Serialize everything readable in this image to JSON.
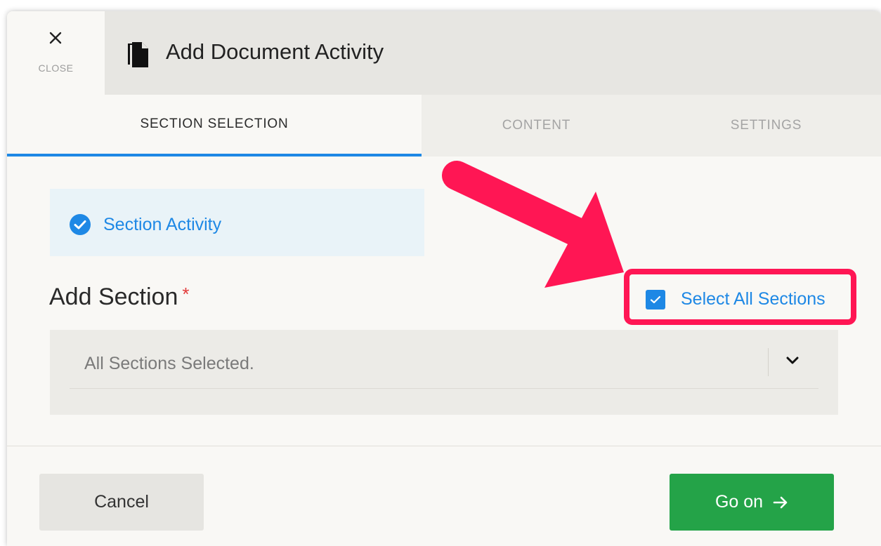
{
  "header": {
    "close_label": "CLOSE",
    "title": "Add Document Activity"
  },
  "tabs": [
    {
      "label": "SECTION SELECTION",
      "active": true
    },
    {
      "label": "CONTENT",
      "active": false
    },
    {
      "label": "SETTINGS",
      "active": false
    }
  ],
  "activity": {
    "label": "Section Activity",
    "checked": true
  },
  "section": {
    "label": "Add Section",
    "required_marker": "*",
    "select_all_label": "Select All Sections",
    "select_all_checked": true,
    "dropdown_value": "All Sections Selected."
  },
  "footer": {
    "cancel_label": "Cancel",
    "go_label": "Go on"
  },
  "colors": {
    "accent": "#1e88e5",
    "primary_button": "#24a348",
    "annotation": "#ff1654",
    "required": "#e23b3b"
  },
  "icons": {
    "close": "close-icon",
    "document": "document-icon",
    "check_circle": "check-circle-icon",
    "checkbox": "checkbox-icon",
    "chevron": "chevron-down-icon",
    "go_arrow": "arrow-right-icon",
    "annotation_arrow": "annotation-arrow"
  }
}
